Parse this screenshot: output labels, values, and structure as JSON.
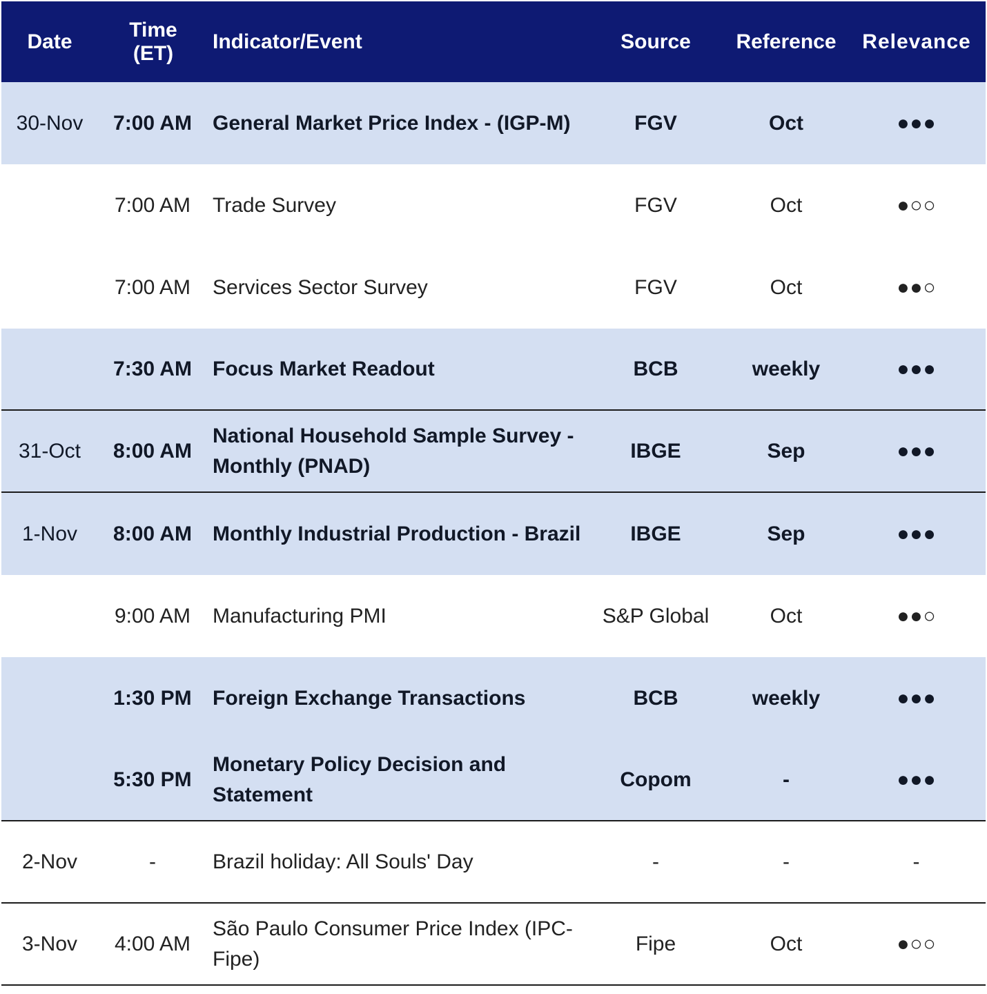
{
  "header": {
    "date": "Date",
    "time": "Time (ET)",
    "indicator": "Indicator/Event",
    "source": "Source",
    "reference": "Reference",
    "relevance": "Relevance"
  },
  "rows": [
    {
      "date": "30-Nov",
      "time": "7:00 AM",
      "indicator": "General Market Price Index -  (IGP-M)",
      "source": "FGV",
      "reference": "Oct",
      "relevance": "●●●"
    },
    {
      "date": "",
      "time": "7:00 AM",
      "indicator": "Trade Survey",
      "source": "FGV",
      "reference": "Oct",
      "relevance": "●○○"
    },
    {
      "date": "",
      "time": "7:00 AM",
      "indicator": "Services Sector Survey",
      "source": "FGV",
      "reference": "Oct",
      "relevance": "●●○"
    },
    {
      "date": "",
      "time": "7:30 AM",
      "indicator": "Focus Market Readout",
      "source": "BCB",
      "reference": "weekly",
      "relevance": "●●●"
    },
    {
      "date": "31-Oct",
      "time": "8:00 AM",
      "indicator": "National Household Sample Survey - Monthly (PNAD)",
      "source": "IBGE",
      "reference": "Sep",
      "relevance": "●●●"
    },
    {
      "date": "1-Nov",
      "time": "8:00 AM",
      "indicator": "Monthly Industrial Production - Brazil",
      "source": "IBGE",
      "reference": "Sep",
      "relevance": "●●●"
    },
    {
      "date": "",
      "time": "9:00 AM",
      "indicator": "Manufacturing PMI",
      "source": "S&P Global",
      "reference": "Oct",
      "relevance": "●●○"
    },
    {
      "date": "",
      "time": "1:30 PM",
      "indicator": "Foreign Exchange Transactions",
      "source": "BCB",
      "reference": "weekly",
      "relevance": "●●●"
    },
    {
      "date": "",
      "time": "5:30 PM",
      "indicator": "Monetary Policy Decision and Statement",
      "source": "Copom",
      "reference": "-",
      "relevance": "●●●"
    },
    {
      "date": "2-Nov",
      "time": "-",
      "indicator": "Brazil holiday: All Souls' Day",
      "source": "-",
      "reference": "-",
      "relevance": "-"
    },
    {
      "date": "3-Nov",
      "time": "4:00 AM",
      "indicator": "São Paulo Consumer Price Index (IPC-Fipe)",
      "source": "Fipe",
      "reference": "Oct",
      "relevance": "●○○"
    }
  ]
}
